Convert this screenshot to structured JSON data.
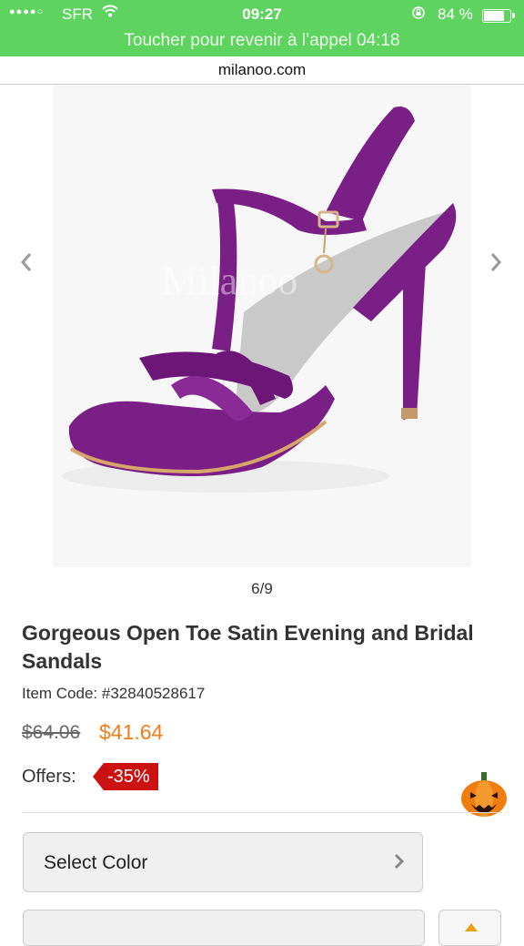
{
  "status_bar": {
    "signal": "●●●●○",
    "carrier": "SFR",
    "time": "09:27",
    "battery_percent": "84 %",
    "battery_level": 0.84,
    "call_banner": "Toucher pour revenir à l’appel 04:18"
  },
  "browser": {
    "url": "milanoo.com"
  },
  "gallery": {
    "watermark": "Milanoo",
    "counter": "6/9",
    "prev_icon": "chevron-left-icon",
    "next_icon": "chevron-right-icon"
  },
  "product": {
    "title": "Gorgeous Open Toe Satin Evening and Bridal Sandals",
    "item_code": "Item Code: #32840528617",
    "old_price": "$64.06",
    "new_price": "$41.64",
    "offers_label": "Offers:",
    "discount": "-35%"
  },
  "options": {
    "select_color_label": "Select Color"
  },
  "colors": {
    "status_green": "#5fd35f",
    "price_orange": "#f07d1a",
    "badge_red": "#cc1111",
    "shoe_purple": "#7a1f86"
  }
}
